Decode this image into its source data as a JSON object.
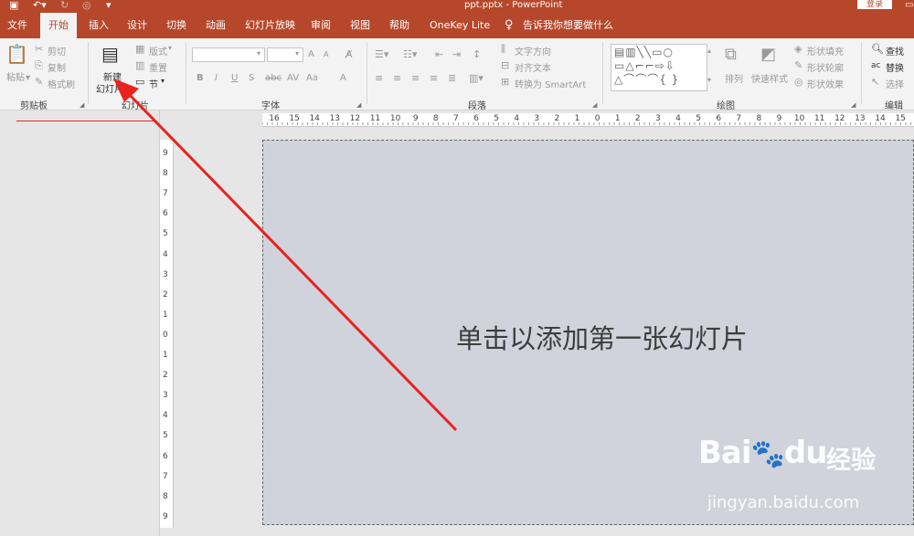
{
  "titlebar": {
    "title": "ppt.pptx  -  PowerPoint",
    "login": "登录",
    "accent": "#b7472a"
  },
  "tabs": [
    "文件",
    "开始",
    "插入",
    "设计",
    "切换",
    "动画",
    "幻灯片放映",
    "审阅",
    "视图",
    "帮助",
    "OneKey Lite"
  ],
  "active_tab": "开始",
  "tell_me": "告诉我你想要做什么",
  "clipboard": {
    "paste": "粘贴",
    "cut": "剪切",
    "copy": "复制",
    "format_painter": "格式刷",
    "label": "剪贴板"
  },
  "slides": {
    "new_slide_line1": "新建",
    "new_slide_line2": "幻灯片",
    "layout": "版式",
    "reset": "重置",
    "section": "节",
    "label": "幻灯片"
  },
  "font": {
    "label": "字体",
    "bold": "B",
    "italic": "I",
    "underline": "U",
    "strike": "S",
    "shadow": "abc",
    "spacing": "AV",
    "case": "Aa",
    "grow": "A",
    "shrink": "A",
    "color": "A"
  },
  "paragraph": {
    "label": "段落",
    "text_direction": "文字方向",
    "align_text": "对齐文本",
    "smartart": "转换为 SmartArt"
  },
  "drawing": {
    "label": "绘图",
    "arrange": "排列",
    "quick_styles": "快速样式",
    "shape_fill": "形状填充",
    "shape_outline": "形状轮廓",
    "shape_effects": "形状效果"
  },
  "editing": {
    "label": "编辑",
    "find": "查找",
    "replace": "替换",
    "select": "选择"
  },
  "ruler": {
    "h": [
      "16",
      "15",
      "14",
      "13",
      "12",
      "11",
      "10",
      "9",
      "8",
      "7",
      "6",
      "5",
      "4",
      "3",
      "2",
      "1",
      "0",
      "1",
      "2",
      "3",
      "4",
      "5",
      "6",
      "7",
      "8",
      "9",
      "10",
      "11",
      "12",
      "13",
      "14",
      "15"
    ],
    "v": [
      "9",
      "8",
      "7",
      "6",
      "5",
      "4",
      "3",
      "2",
      "1",
      "0",
      "1",
      "2",
      "3",
      "4",
      "5",
      "6",
      "7",
      "8",
      "9"
    ]
  },
  "slide": {
    "placeholder": "单击以添加第一张幻灯片",
    "background": "#d0d3dc"
  },
  "watermark": {
    "brand": "Bai",
    "brand2": "du",
    "cn": "经验",
    "url": "jingyan.baidu.com"
  },
  "annotation": {
    "arrow_color": "#e8231d"
  }
}
